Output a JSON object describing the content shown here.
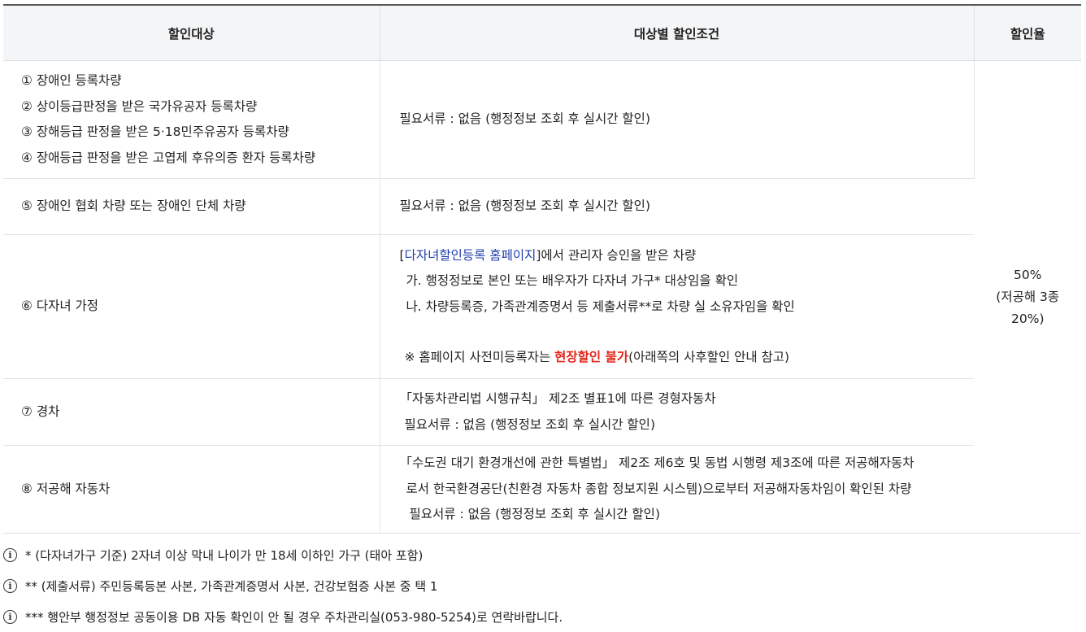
{
  "table": {
    "headers": [
      "할인대상",
      "대상별 할인조건",
      "할인율"
    ],
    "rows": [
      {
        "targets": [
          "① 장애인 등록차량",
          "② 상이등급판정을 받은 국가유공자 등록차량",
          "③ 장해등급 판정을 받은 5·18민주유공자 등록차량",
          "④ 장애등급 판정을 받은 고엽제 후유의증 환자 등록차량"
        ],
        "condition": "필요서류 : 없음 (행정정보 조회 후 실시간 할인)"
      },
      {
        "target": "⑤ 장애인 협회 차량 또는 장애인 단체 차량",
        "condition": "필요서류 : 없음 (행정정보 조회 후 실시간 할인)"
      },
      {
        "target": "⑥ 다자녀 가정",
        "bracket_open": "[",
        "link_text": "다자녀할인등록 홈페이지",
        "line1_rest": "]에서 관리자 승인을 받은 차량",
        "line2": "가. 행정정보로 본인 또는 배우자가 다자녀 가구* 대상임을 확인",
        "line3": "나. 차량등록증, 가족관계증명서 등 제출서류**로 차량 실 소유자임을 확인",
        "note_pre": "※ 홈페이지 사전미등록자는 ",
        "note_red": "현장할인 불가",
        "note_post": "(아래쪽의 사후할인 안내 참고)"
      },
      {
        "target": "⑦ 경차",
        "line1": "「자동차관리법 시행규칙」 제2조 별표1에 따른 경형자동차",
        "line2": "필요서류 : 없음 (행정정보 조회 후 실시간 할인)"
      },
      {
        "target": "⑧ 저공해 자동차",
        "line1": "「수도권 대기 환경개선에 관한 특별법」 제2조 제6호 및 동법 시행령 제3조에 따른 저공해자동차",
        "line2": "로서 한국환경공단(친환경 자동차 종합 정보지원 시스템)으로부터 저공해자동차임이 확인된 차량",
        "line3": "필요서류 : 없음 (행정정보 조회 후 실시간 할인)"
      }
    ],
    "rate": [
      "50%",
      "(저공해 3종",
      "20%)"
    ]
  },
  "notes": [
    "* (다자녀가구 기준) 2자녀 이상 막내 나이가 만 18세 이하인 가구 (태아 포함)",
    "** (제출서류) 주민등록등본 사본, 가족관계증명서 사본, 건강보험증 사본 중 택 1",
    "*** 행안부 행정정보 공동이용 DB 자동 확인이 안 될 경우 주차관리실(053-980-5254)로 연락바랍니다."
  ],
  "info_glyph": "i",
  "colors": {
    "link": "#1f3fae",
    "emphasis": "#e1251b",
    "header_bg": "#f4f5f7"
  }
}
